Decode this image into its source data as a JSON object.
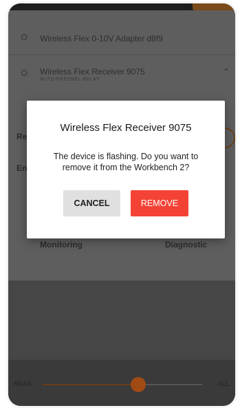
{
  "background_list": {
    "devices": [
      {
        "name": "Wireless Flex 0-10V Adapter d8f9",
        "subtitle": ""
      },
      {
        "name": "Wireless Flex Receiver 9075",
        "subtitle": "AUTO-FRESNEL RELAY"
      }
    ],
    "ghost_labels": [
      "Re",
      "En",
      "Monitoring",
      "Diagnostic"
    ]
  },
  "slider": {
    "left_label": "NEAR",
    "right_label": "ALL",
    "value_fraction": 0.6
  },
  "dialog": {
    "title": "Wireless Flex Receiver 9075",
    "message": "The device is flashing. Do you want to remove it from the Workbench 2?",
    "cancel_label": "CANCEL",
    "remove_label": "REMOVE"
  },
  "colors": {
    "remove_button": "#f44336",
    "cancel_button": "#e0e0e0",
    "slider_thumb": "#a04a14"
  }
}
